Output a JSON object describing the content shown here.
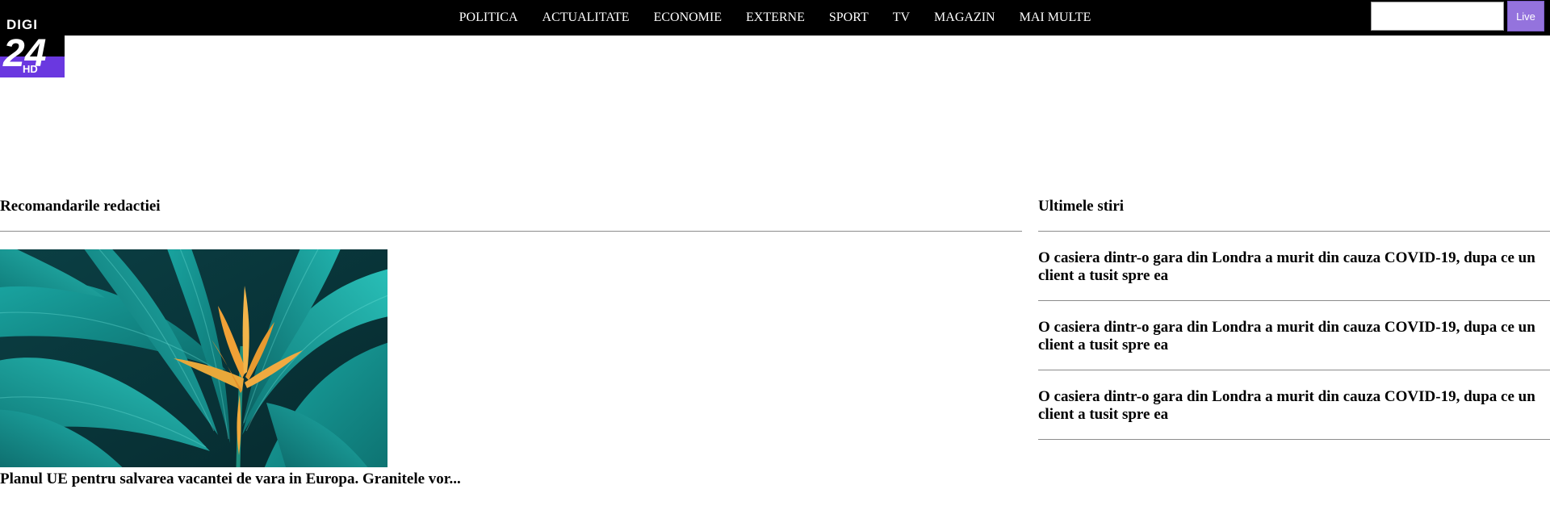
{
  "brand": {
    "logo_top": "DIGI",
    "logo_num": "24",
    "logo_badge": "HD",
    "accent": "#6a38e0"
  },
  "nav": {
    "items": [
      {
        "label": "POLITICA"
      },
      {
        "label": "ACTUALITATE"
      },
      {
        "label": "ECONOMIE"
      },
      {
        "label": "EXTERNE"
      },
      {
        "label": "SPORT"
      },
      {
        "label": "TV"
      },
      {
        "label": "MAGAZIN"
      },
      {
        "label": "MAI MULTE"
      }
    ]
  },
  "search": {
    "value": "",
    "button_label": "Live",
    "button_color": "#9473dd"
  },
  "recommendations": {
    "title": "Recomandarile redactiei",
    "feature": {
      "headline": "Planul UE pentru salvarea vacantei de vara in Europa. Granitele vor..."
    }
  },
  "latest": {
    "title": "Ultimele stiri",
    "items": [
      {
        "headline": "O casiera dintr-o gara din Londra a murit din cauza COVID-19, dupa ce un client a tusit spre ea"
      },
      {
        "headline": "O casiera dintr-o gara din Londra a murit din cauza COVID-19, dupa ce un client a tusit spre ea"
      },
      {
        "headline": "O casiera dintr-o gara din Londra a murit din cauza COVID-19, dupa ce un client a tusit spre ea"
      }
    ]
  }
}
